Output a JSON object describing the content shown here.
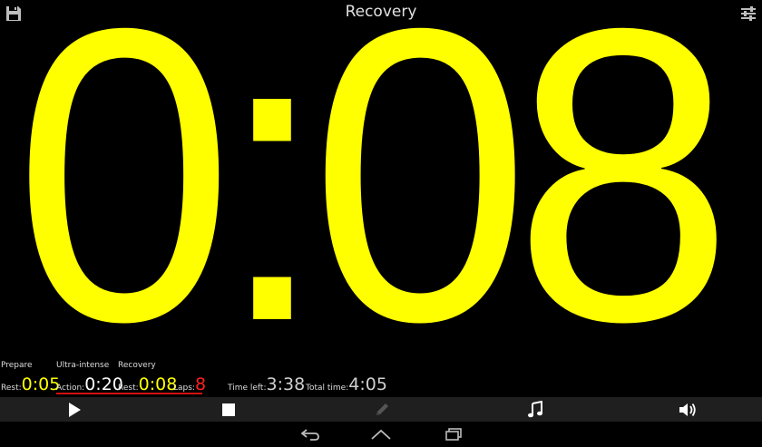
{
  "header": {
    "title": "Recovery"
  },
  "timer": {
    "display": "0:08",
    "color": "#ffff00"
  },
  "phases": [
    "Prepare",
    "Ultra-intense",
    "Recovery"
  ],
  "stats": {
    "rest1_label": "Rest:",
    "rest1_value": "0:05",
    "action_label": "Action:",
    "action_value": "0:20",
    "rest2_label": "Rest:",
    "rest2_value": "0:08",
    "laps_label": "Laps:",
    "laps_value": "8",
    "time_left_label": "Time left:",
    "time_left_value": "3:38",
    "total_time_label": "Total time:",
    "total_time_value": "4:05"
  },
  "toolbar": {
    "play_icon": "play-icon",
    "stop_icon": "stop-icon",
    "edit_icon": "pencil-icon",
    "music_icon": "music-note-icon",
    "sound_icon": "speaker-icon"
  },
  "nav": {
    "back_icon": "back-icon",
    "home_icon": "home-icon",
    "recents_icon": "recents-icon"
  },
  "colors": {
    "accent_yellow": "#ffff00",
    "laps_red": "#ff2020",
    "underline_red": "#d01010",
    "toolbar_bg": "#1f1f1f"
  }
}
